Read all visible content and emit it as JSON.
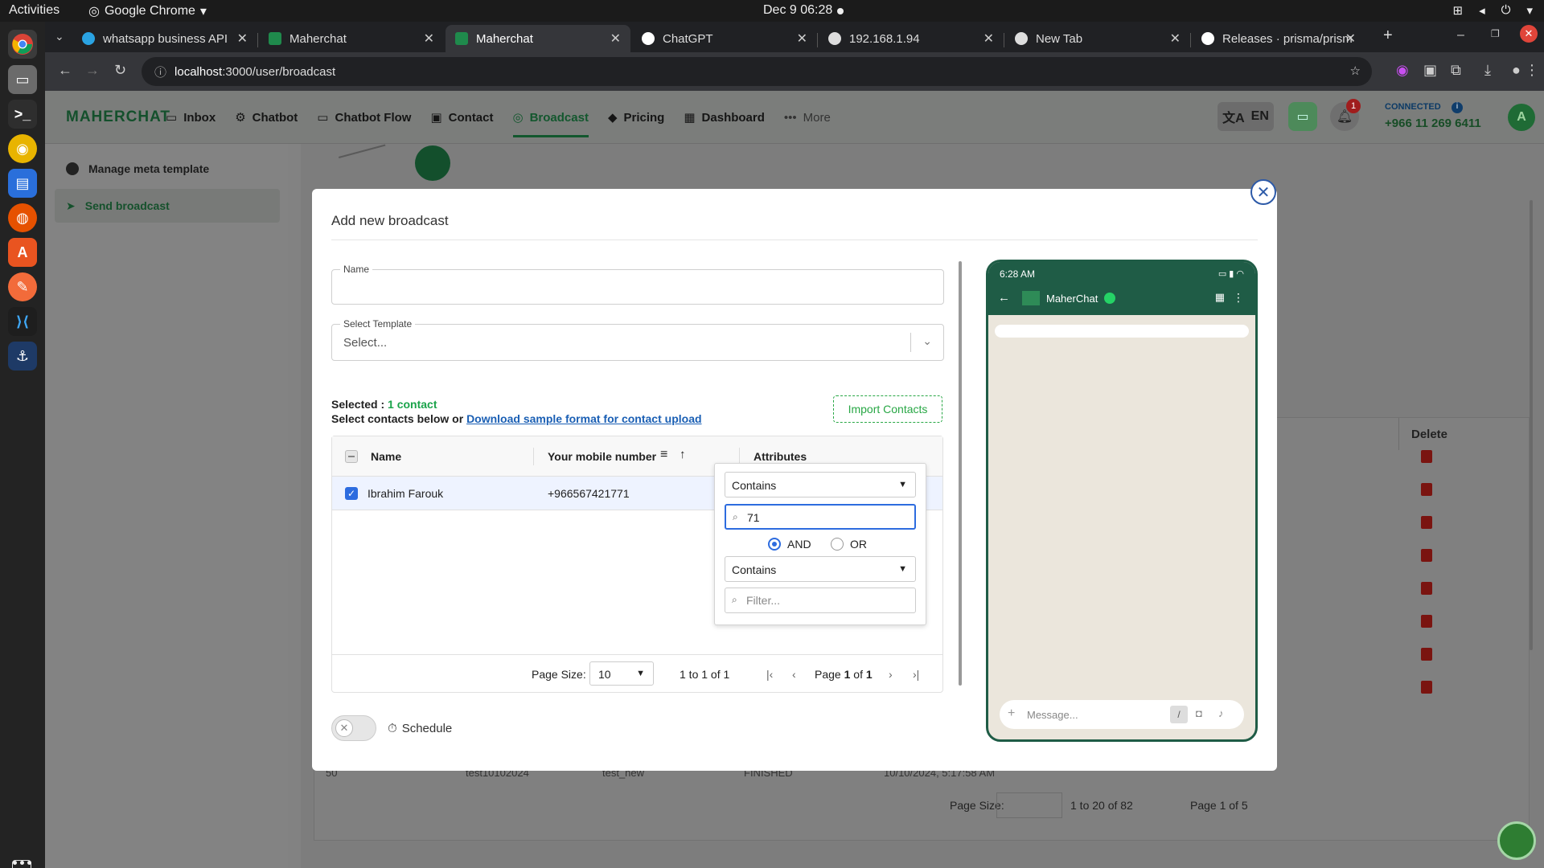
{
  "system": {
    "activities": "Activities",
    "app_name": "Google Chrome",
    "clock": "Dec 9  06:28"
  },
  "browser": {
    "tabs": [
      {
        "title": "whatsapp business API"
      },
      {
        "title": "Maherchat"
      },
      {
        "title": "Maherchat"
      },
      {
        "title": "ChatGPT"
      },
      {
        "title": "192.168.1.94"
      },
      {
        "title": "New Tab"
      },
      {
        "title": "Releases · prisma/prism"
      }
    ],
    "url_host": "localhost",
    "url_path": ":3000/user/broadcast"
  },
  "app": {
    "logo": "MAHERCHAT",
    "nav": [
      "Inbox",
      "Chatbot",
      "Chatbot Flow",
      "Contact",
      "Broadcast",
      "Pricing",
      "Dashboard",
      "More"
    ],
    "lang": "EN",
    "notif_count": "1",
    "status_label": "CONNECTED",
    "phone_number": "+966 11 269 6411",
    "avatar": "A",
    "sidebar": [
      "Manage meta template",
      "Send broadcast"
    ],
    "bg_table": {
      "delete_header": "Delete",
      "partial_row": [
        "50",
        "test10102024",
        "test_new",
        "FINISHED",
        "10/10/2024, 5:17:58 AM"
      ],
      "page_size_label": "Page Size:",
      "range": "1 to 20 of 82",
      "page": "Page 1 of 5"
    }
  },
  "modal": {
    "title": "Add new broadcast",
    "name_label": "Name",
    "name_value": "",
    "template_label": "Select Template",
    "template_placeholder": "Select...",
    "selected_label": "Selected :",
    "selected_value": "1 contact",
    "select_hint": "Select contacts below or",
    "download_link": "Download sample format for contact upload",
    "import_button": "Import Contacts",
    "grid": {
      "col_name": "Name",
      "col_mobile": "Your mobile number",
      "col_attributes": "Attributes",
      "rows": [
        {
          "name": "Ibrahim Farouk",
          "mobile": "+966567421771",
          "checked": true
        }
      ],
      "page_size_label": "Page Size:",
      "page_size": "10",
      "range": "1 to 1 of 1",
      "page_label": "Page",
      "page_current": "1",
      "page_of": "of",
      "page_total": "1"
    },
    "filter": {
      "op1": "Contains",
      "value1": "71",
      "and_label": "AND",
      "or_label": "OR",
      "selected_join": "AND",
      "op2": "Contains",
      "value2_placeholder": "Filter..."
    },
    "schedule_label": "Schedule",
    "preview": {
      "time": "6:28 AM",
      "contact_name": "MaherChat",
      "message_placeholder": "Message..."
    }
  },
  "colors": {
    "brand_green": "#1f5c46",
    "accent_blue": "#2d6cdf",
    "import_green": "#28a745"
  }
}
